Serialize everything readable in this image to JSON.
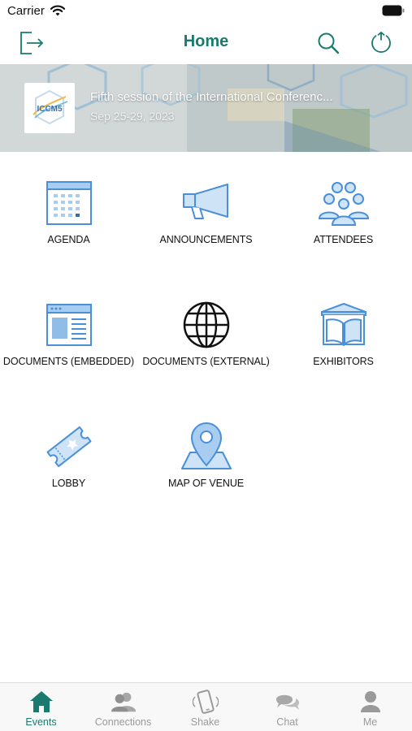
{
  "status_bar": {
    "carrier": "Carrier"
  },
  "nav": {
    "title": "Home"
  },
  "banner": {
    "title": "Fifth session of the International Conferenc...",
    "date": "Sep 25-29, 2023",
    "logo_text": "ICCM5"
  },
  "tiles": [
    {
      "label": "AGENDA",
      "icon": "calendar-icon"
    },
    {
      "label": "ANNOUNCEMENTS",
      "icon": "megaphone-icon"
    },
    {
      "label": "ATTENDEES",
      "icon": "people-group-icon"
    },
    {
      "label": "DOCUMENTS (EMBEDDED)",
      "icon": "document-window-icon"
    },
    {
      "label": "DOCUMENTS (EXTERNAL)",
      "icon": "globe-icon"
    },
    {
      "label": "EXHIBITORS",
      "icon": "open-book-icon"
    },
    {
      "label": "LOBBY",
      "icon": "ticket-icon"
    },
    {
      "label": "MAP OF VENUE",
      "icon": "map-pin-icon"
    }
  ],
  "tab_bar": {
    "active": "Events",
    "tabs": [
      {
        "label": "Events",
        "icon": "house-icon"
      },
      {
        "label": "Connections",
        "icon": "connections-icon"
      },
      {
        "label": "Shake",
        "icon": "shake-phone-icon"
      },
      {
        "label": "Chat",
        "icon": "chat-bubbles-icon"
      },
      {
        "label": "Me",
        "icon": "person-icon"
      }
    ]
  },
  "colors": {
    "accent": "#1a7a6e",
    "icon_blue": "#4a90d9",
    "icon_fill": "#cfe3f7",
    "tab_inactive": "#9a9a9a"
  }
}
